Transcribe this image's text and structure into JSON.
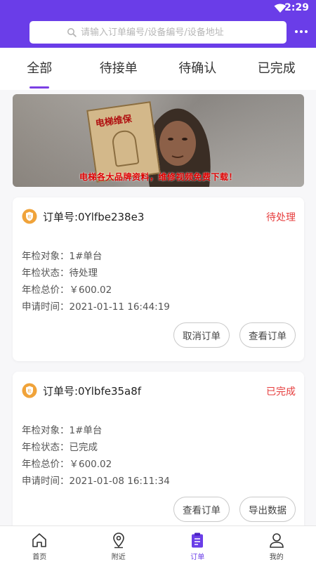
{
  "status_bar": {
    "time": "2:29"
  },
  "search": {
    "placeholder": "请输入订单编号/设备编号/设备地址"
  },
  "tabs": [
    {
      "label": "全部",
      "active": true
    },
    {
      "label": "待接单",
      "active": false
    },
    {
      "label": "待确认",
      "active": false
    },
    {
      "label": "已完成",
      "active": false
    }
  ],
  "banner": {
    "book_title": "电梯维保",
    "caption": "电梯各大品牌资料，维修视频免费下载！"
  },
  "orders": [
    {
      "order_no": "订单号:0Ylfbe238e3",
      "status": "待处理",
      "rows": [
        {
          "label": "年检对象：",
          "value": "1#单台"
        },
        {
          "label": "年检状态：",
          "value": "待处理"
        },
        {
          "label": "年检总价：",
          "value": "￥600.02"
        },
        {
          "label": "申请时间：",
          "value": "2021-01-11 16:44:19"
        }
      ],
      "buttons": [
        "取消订单",
        "查看订单"
      ]
    },
    {
      "order_no": "订单号:0Ylbfe35a8f",
      "status": "已完成",
      "rows": [
        {
          "label": "年检对象：",
          "value": "1#单台"
        },
        {
          "label": "年检状态：",
          "value": "已完成"
        },
        {
          "label": "年检总价：",
          "value": "￥600.02"
        },
        {
          "label": "申请时间：",
          "value": "2021-01-08 16:11:34"
        }
      ],
      "buttons": [
        "查看订单",
        "导出数据"
      ]
    }
  ],
  "bottom_nav": [
    {
      "label": "首页",
      "icon": "home-icon"
    },
    {
      "label": "附近",
      "icon": "location-pin-icon"
    },
    {
      "label": "订单",
      "icon": "clipboard-icon",
      "active": true
    },
    {
      "label": "我的",
      "icon": "user-icon"
    }
  ],
  "colors": {
    "brand": "#6a3de8",
    "status_red": "#e63d3d",
    "order_icon": "#f0a33a"
  }
}
